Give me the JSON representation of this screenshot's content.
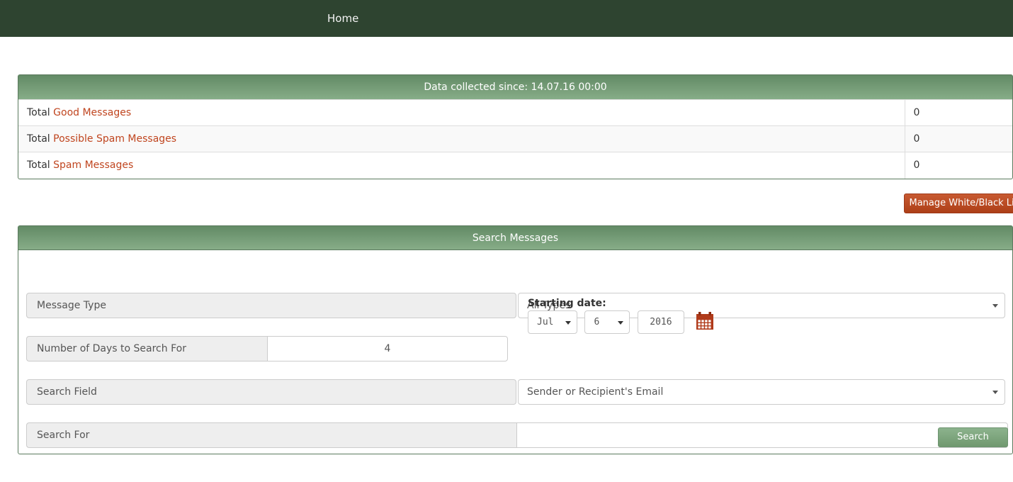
{
  "navbar": {
    "brand_color": "#2e4430",
    "items": [
      {
        "label": "Home"
      }
    ]
  },
  "summary_panel": {
    "title": "Data collected since: 14.07.16 00:00",
    "header_gradient_from": "#628a65",
    "header_gradient_to": "#87ad88",
    "link_color": "#c0451f",
    "rows": [
      {
        "prefix": "Total",
        "link": "Good Messages",
        "value": "0"
      },
      {
        "prefix": "Total",
        "link": "Possible Spam Messages",
        "value": "0"
      },
      {
        "prefix": "Total",
        "link": "Spam Messages",
        "value": "0"
      }
    ]
  },
  "manage_button": {
    "label": "Manage White/Black List",
    "color": "#ad3f18"
  },
  "search_panel": {
    "title": "Search Messages",
    "message_type": {
      "label": "Message Type",
      "selected": "All Types"
    },
    "days": {
      "label": "Number of Days to Search For",
      "value": "4"
    },
    "starting_date": {
      "label": "Starting date:",
      "month": "Jul",
      "day": "6",
      "year": "2016",
      "calendar_icon": "calendar-icon",
      "icon_color": "#b03a1a"
    },
    "search_field": {
      "label": "Search Field",
      "selected": "Sender or Recipient's Email"
    },
    "search_for": {
      "label": "Search For",
      "value": "",
      "placeholder": ""
    },
    "search_button": {
      "label": "Search"
    }
  }
}
